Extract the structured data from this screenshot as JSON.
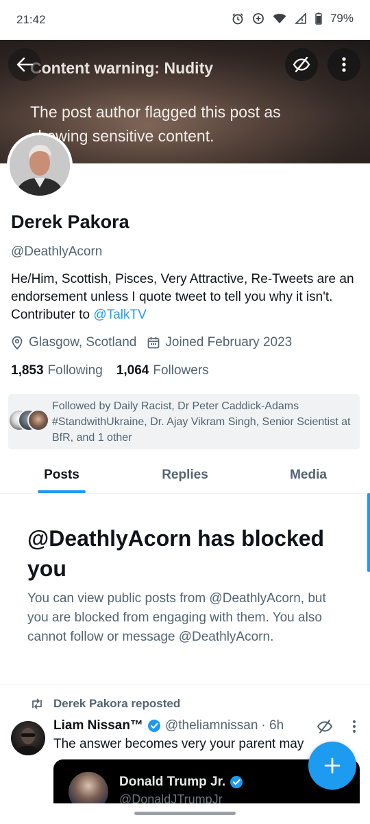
{
  "status_bar": {
    "time": "21:42",
    "battery": "79%",
    "icons": [
      "alarm-icon",
      "data-saver-icon",
      "wifi-icon",
      "signal-icon",
      "battery-icon"
    ]
  },
  "banner": {
    "title": "Content warning: Nudity",
    "body": "The post author flagged this post as showing sensitive content.",
    "icons": [
      "back-arrow-icon",
      "eye-off-icon",
      "more-vertical-icon"
    ]
  },
  "profile": {
    "display_name": "Derek Pakora",
    "handle": "@DeathlyAcorn",
    "bio_text": "He/Him,  Scottish, Pisces, Very Attractive,  Re-Tweets are an endorsement unless I quote tweet to tell you why it isn't. Contributer to ",
    "bio_link": "@TalkTV",
    "location": "Glasgow, Scotland",
    "joined": "Joined February 2023",
    "following_count": "1,853",
    "following_label": "Following",
    "followers_count": "1,064",
    "followers_label": "Followers",
    "followed_by": "Followed by Daily Racist, Dr Peter Caddick-Adams #StandwithUkraine, Dr. Ajay Vikram Singh, Senior Scientist at BfR, and 1 other"
  },
  "tabs": [
    {
      "label": "Posts",
      "active": true
    },
    {
      "label": "Replies",
      "active": false
    },
    {
      "label": "Media",
      "active": false
    }
  ],
  "blocked": {
    "title": "@DeathlyAcorn has blocked you",
    "body": "You can view public posts from @DeathlyAcorn, but you are blocked from engaging with them. You also cannot follow or message @DeathlyAcorn."
  },
  "post": {
    "repost_label": "Derek Pakora reposted",
    "author_name": "Liam Nissan™",
    "author_handle": "@theliamnissan",
    "time": "· 6h",
    "text": "The answer becomes very your parent may",
    "quote": {
      "author_name": "Donald Trump Jr.",
      "author_handle": "@DonaldJTrumpJr"
    }
  },
  "colors": {
    "accent": "#1d9bf0",
    "text_primary": "#0f1419",
    "text_secondary": "#536471"
  }
}
